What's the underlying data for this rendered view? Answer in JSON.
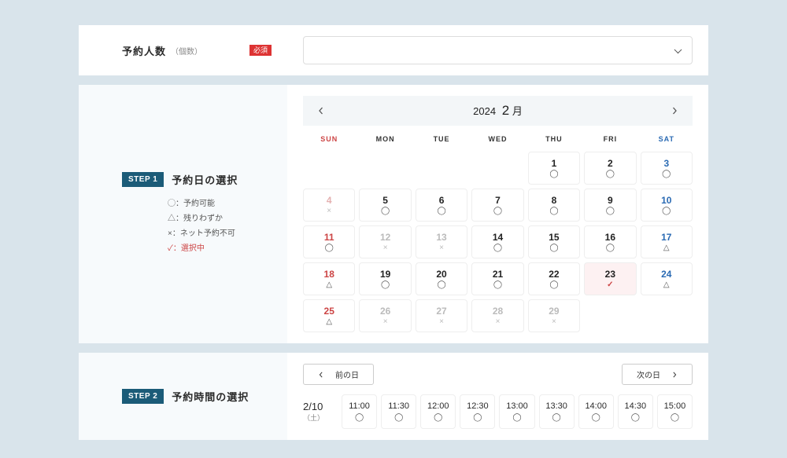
{
  "sections": {
    "guests": {
      "label": "予約人数",
      "sublabel": "（個数）",
      "required_badge": "必須"
    }
  },
  "step1": {
    "badge": "STEP 1",
    "title": "予約日の選択",
    "legend": {
      "available": "◯：予約可能",
      "few": "△：残りわずか",
      "unavailable": "×：ネット予約不可",
      "selected": "✓：選択中"
    }
  },
  "calendar": {
    "year": "2024",
    "month_label": "2",
    "month_suffix": "月",
    "dow": [
      "SUN",
      "MON",
      "TUE",
      "WED",
      "THU",
      "FRI",
      "SAT"
    ],
    "weeks": [
      [
        {
          "empty": true
        },
        {
          "empty": true
        },
        {
          "empty": true
        },
        {
          "empty": true
        },
        {
          "day": "1",
          "sym": "◯"
        },
        {
          "day": "2",
          "sym": "◯"
        },
        {
          "day": "3",
          "sym": "◯",
          "sat": true
        }
      ],
      [
        {
          "day": "4",
          "sym": "×",
          "sun": true,
          "disabled": true
        },
        {
          "day": "5",
          "sym": "◯"
        },
        {
          "day": "6",
          "sym": "◯"
        },
        {
          "day": "7",
          "sym": "◯"
        },
        {
          "day": "8",
          "sym": "◯"
        },
        {
          "day": "9",
          "sym": "◯"
        },
        {
          "day": "10",
          "sym": "◯",
          "sat": true
        }
      ],
      [
        {
          "day": "11",
          "sym": "◯",
          "sun": true
        },
        {
          "day": "12",
          "sym": "×",
          "disabled": true
        },
        {
          "day": "13",
          "sym": "×",
          "disabled": true
        },
        {
          "day": "14",
          "sym": "◯"
        },
        {
          "day": "15",
          "sym": "◯"
        },
        {
          "day": "16",
          "sym": "◯"
        },
        {
          "day": "17",
          "sym": "△",
          "sat": true
        }
      ],
      [
        {
          "day": "18",
          "sym": "△",
          "sun": true
        },
        {
          "day": "19",
          "sym": "◯"
        },
        {
          "day": "20",
          "sym": "◯"
        },
        {
          "day": "21",
          "sym": "◯"
        },
        {
          "day": "22",
          "sym": "◯"
        },
        {
          "day": "23",
          "sym": "✓",
          "selected": true
        },
        {
          "day": "24",
          "sym": "△",
          "sat": true
        }
      ],
      [
        {
          "day": "25",
          "sym": "△",
          "sun": true
        },
        {
          "day": "26",
          "sym": "×",
          "disabled": true
        },
        {
          "day": "27",
          "sym": "×",
          "disabled": true
        },
        {
          "day": "28",
          "sym": "×",
          "disabled": true
        },
        {
          "day": "29",
          "sym": "×",
          "disabled": true
        },
        {
          "empty": true
        },
        {
          "empty": true
        }
      ]
    ]
  },
  "step2": {
    "badge": "STEP 2",
    "title": "予約時間の選択",
    "prev_day": "前の日",
    "next_day": "次の日",
    "date": "2/10",
    "weekday": "（土）",
    "slots": [
      {
        "time": "11:00",
        "sym": "◯"
      },
      {
        "time": "11:30",
        "sym": "◯"
      },
      {
        "time": "12:00",
        "sym": "◯"
      },
      {
        "time": "12:30",
        "sym": "◯"
      },
      {
        "time": "13:00",
        "sym": "◯"
      },
      {
        "time": "13:30",
        "sym": "◯"
      },
      {
        "time": "14:00",
        "sym": "◯"
      },
      {
        "time": "14:30",
        "sym": "◯"
      },
      {
        "time": "15:00",
        "sym": "◯"
      }
    ]
  }
}
